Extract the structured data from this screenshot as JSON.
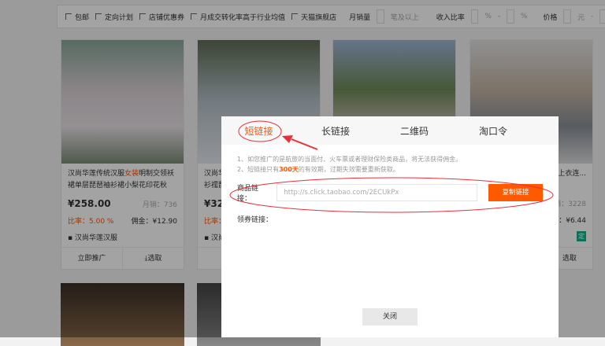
{
  "filters": {
    "items": [
      "包邮",
      "定向计划",
      "店铺优惠券",
      "月成交转化率高于行业均值",
      "天猫旗舰店"
    ],
    "monthly_sales_label": "月销量",
    "monthly_sales_suffix": "笔及以上",
    "income_ratio_label": "收入比率",
    "percent": "%",
    "dash": "-",
    "price_label": "价格",
    "yuan": "元"
  },
  "cards": [
    {
      "title_a": "汉尚华莲传统汉服",
      "title_hl": "女装",
      "title_b": "明制交领袄裙单层琵琶袖衫裙小梨花印花秋",
      "price": "¥258.00",
      "sales": "月销：736",
      "ratio": "比率：5.00 %",
      "commission": "佣金：¥12.90",
      "shop": "汉尚华莲汉服",
      "promote": "立即推广",
      "select": "⤓选取"
    },
    {
      "title": "汉尚华",
      "title2": "衫襦琵",
      "price": "¥32",
      "ratio": "比率：",
      "shop": "汉尚",
      "promote": "立"
    },
    {},
    {
      "title": "上衣连...",
      "sales": "销：3228",
      "commission": "：¥6.44",
      "badge": "定",
      "select": "选取"
    }
  ],
  "modal": {
    "tabs": [
      "短链接",
      "长链接",
      "二维码",
      "淘口令"
    ],
    "note1": "1、如您推广的是航旅的当面付、火车票或者理财保险类商品，将无法获得佣金。",
    "note2_a": "2、短链接只有",
    "note2_hl": "300天",
    "note2_b": "的有效期，过期失效需要重新获取。",
    "item_link_label": "商品链接：",
    "item_link": "http://s.click.taobao.com/2ECUkPx",
    "copy": "复制链接",
    "coupon_label": "领券链接：",
    "close": "关闭"
  },
  "colors": {
    "accent": "#ff5500",
    "annotation": "#e8303a"
  }
}
